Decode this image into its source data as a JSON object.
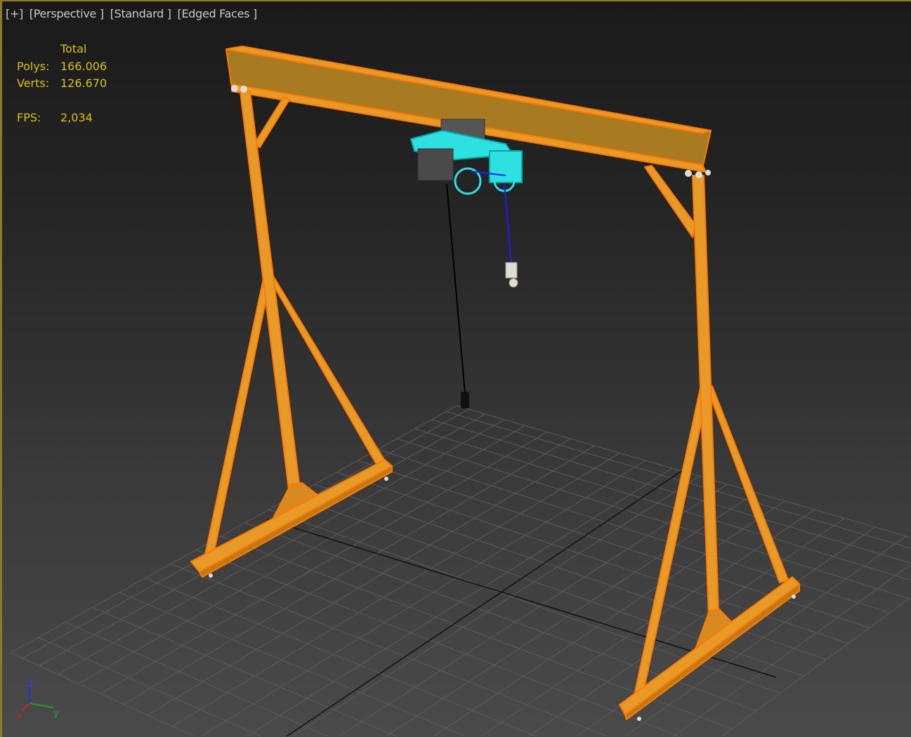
{
  "viewport": {
    "labels": [
      "[+]",
      "[Perspective ]",
      "[Standard ]",
      "[Edged Faces ]"
    ],
    "stats": {
      "header": "Total",
      "rows": [
        {
          "key": "Polys:",
          "value": "166.006"
        },
        {
          "key": "Verts:",
          "value": "126.670"
        }
      ],
      "fps_key": "FPS:",
      "fps_value": "2,034"
    },
    "axis_gizmo": {
      "x": "x",
      "y": "y",
      "z": "z"
    },
    "colors": {
      "frame": "#e89a28",
      "edge": "#ff7a00",
      "hoist": "#22dede",
      "stats": "#d8c21a",
      "active_border": "#8c7a2c"
    }
  }
}
